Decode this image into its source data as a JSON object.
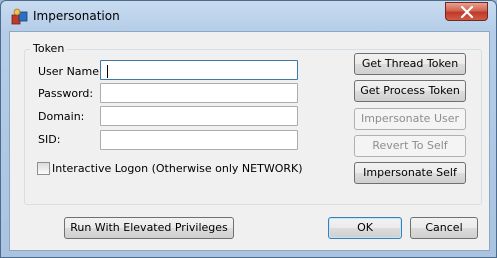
{
  "window": {
    "title": "Impersonation"
  },
  "group": {
    "label": "Token"
  },
  "fields": {
    "username": {
      "label": "User Name:",
      "value": ""
    },
    "password": {
      "label": "Password:",
      "value": ""
    },
    "domain": {
      "label": "Domain:",
      "value": ""
    },
    "sid": {
      "label": "SID:",
      "value": ""
    }
  },
  "checkbox": {
    "label": "Interactive Logon (Otherwise only NETWORK)",
    "checked": false
  },
  "buttons": {
    "get_thread_token": "Get Thread Token",
    "get_process_token": "Get Process Token",
    "impersonate_user": "Impersonate User",
    "revert_to_self": "Revert To Self",
    "impersonate_self": "Impersonate Self",
    "run_elevated": "Run With Elevated Privileges",
    "ok": "OK",
    "cancel": "Cancel"
  },
  "icons": {
    "app": "impersonation-app-icon",
    "close": "close-icon"
  }
}
